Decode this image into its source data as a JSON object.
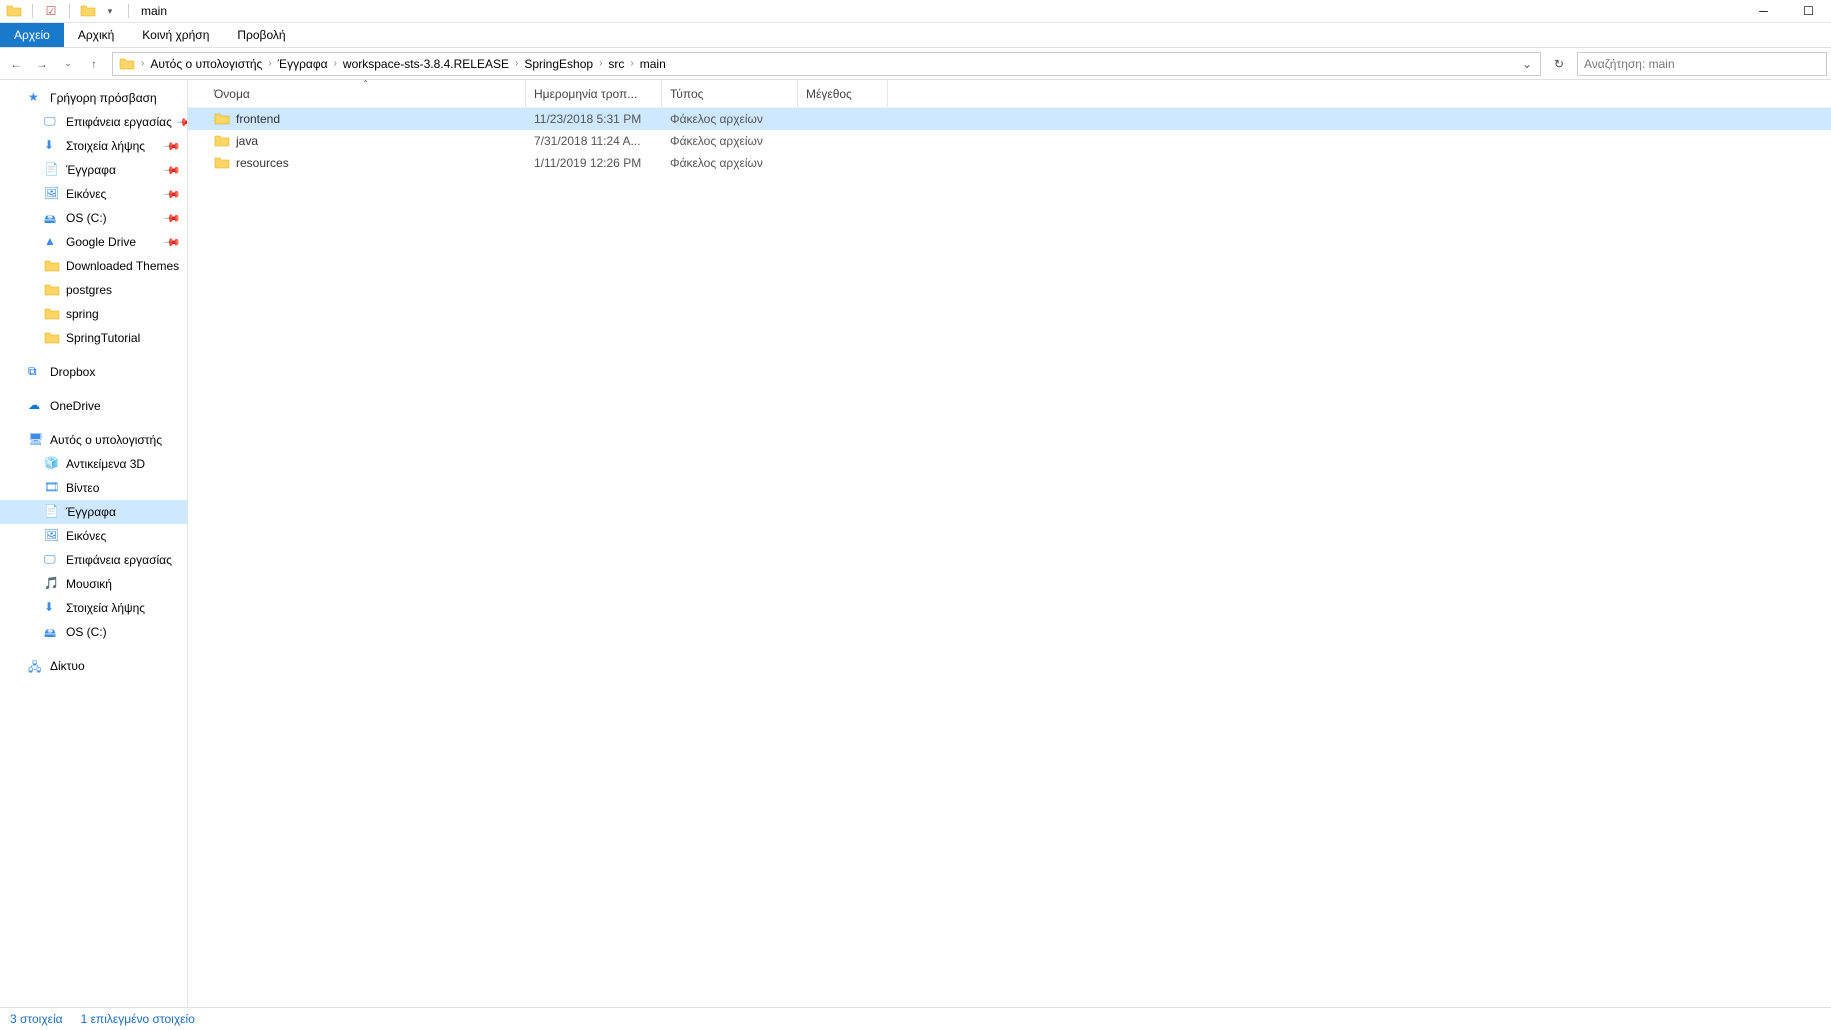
{
  "window": {
    "title": "main"
  },
  "ribbon": {
    "file": "Αρχείο",
    "tabs": [
      "Αρχική",
      "Κοινή χρήση",
      "Προβολή"
    ]
  },
  "breadcrumb": [
    "Αυτός ο υπολογιστής",
    "Έγγραφα",
    "workspace-sts-3.8.4.RELEASE",
    "SpringEshop",
    "src",
    "main"
  ],
  "search": {
    "placeholder": "Αναζήτηση: main"
  },
  "sidebar": {
    "quick": {
      "label": "Γρήγορη πρόσβαση",
      "items": [
        {
          "label": "Επιφάνεια εργασίας",
          "pinned": true,
          "icon": "desktop"
        },
        {
          "label": "Στοιχεία λήψης",
          "pinned": true,
          "icon": "downloads"
        },
        {
          "label": "Έγγραφα",
          "pinned": true,
          "icon": "documents"
        },
        {
          "label": "Εικόνες",
          "pinned": true,
          "icon": "pictures"
        },
        {
          "label": "OS (C:)",
          "pinned": true,
          "icon": "disk"
        },
        {
          "label": "Google Drive",
          "pinned": true,
          "icon": "gdrive"
        },
        {
          "label": "Downloaded Themes",
          "pinned": false,
          "icon": "folder"
        },
        {
          "label": "postgres",
          "pinned": false,
          "icon": "folder"
        },
        {
          "label": "spring",
          "pinned": false,
          "icon": "folder"
        },
        {
          "label": "SpringTutorial",
          "pinned": false,
          "icon": "folder"
        }
      ]
    },
    "dropbox": "Dropbox",
    "onedrive": "OneDrive",
    "thispc": {
      "label": "Αυτός ο υπολογιστής",
      "items": [
        {
          "label": "Αντικείμενα 3D",
          "icon": "3d"
        },
        {
          "label": "Βίντεο",
          "icon": "video"
        },
        {
          "label": "Έγγραφα",
          "icon": "documents",
          "selected": true
        },
        {
          "label": "Εικόνες",
          "icon": "pictures"
        },
        {
          "label": "Επιφάνεια εργασίας",
          "icon": "desktop"
        },
        {
          "label": "Μουσική",
          "icon": "music"
        },
        {
          "label": "Στοιχεία λήψης",
          "icon": "downloads"
        },
        {
          "label": "OS (C:)",
          "icon": "disk"
        }
      ]
    },
    "network": "Δίκτυο"
  },
  "columns": {
    "name": "Όνομα",
    "date": "Ημερομηνία τροπ...",
    "type": "Τύπος",
    "size": "Μέγεθος"
  },
  "files": [
    {
      "name": "frontend",
      "date": "11/23/2018 5:31 PM",
      "type": "Φάκελος αρχείων",
      "size": "",
      "selected": true
    },
    {
      "name": "java",
      "date": "7/31/2018 11:24 A...",
      "type": "Φάκελος αρχείων",
      "size": ""
    },
    {
      "name": "resources",
      "date": "1/11/2019 12:26 PM",
      "type": "Φάκελος αρχείων",
      "size": ""
    }
  ],
  "status": {
    "count": "3 στοιχεία",
    "selected": "1 επιλεγμένο στοιχείο"
  }
}
